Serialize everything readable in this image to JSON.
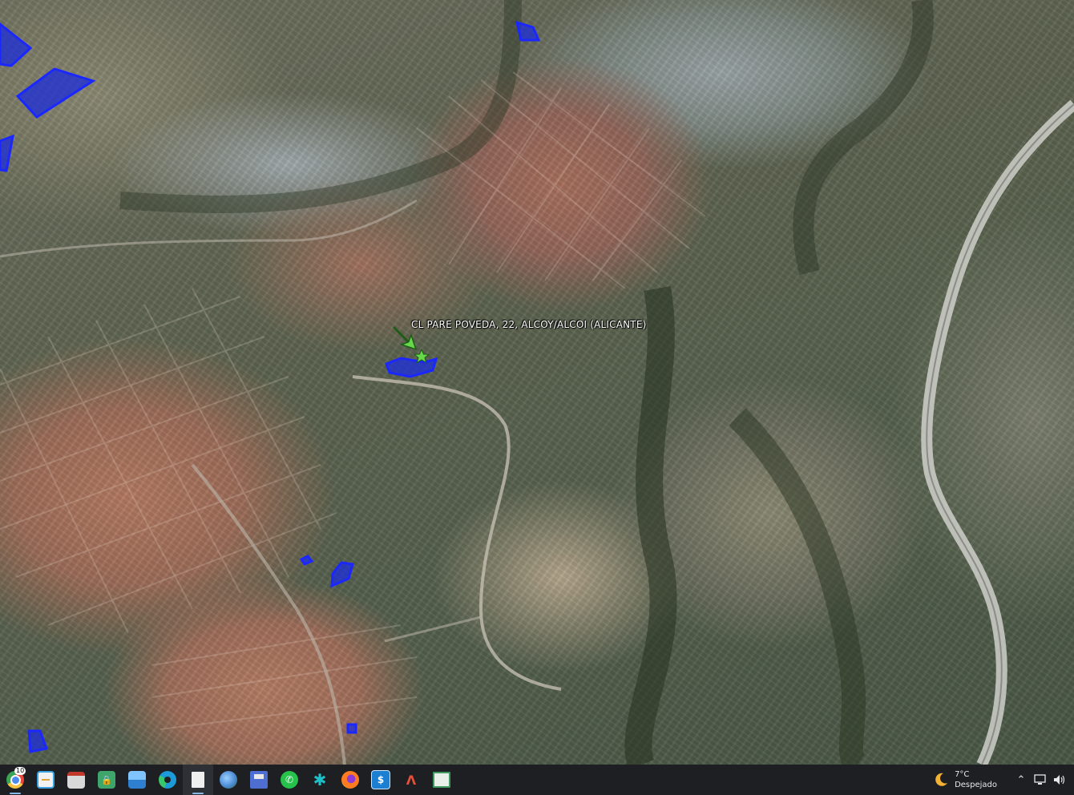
{
  "map": {
    "placemark_label": "CL PARE POVEDA, 22, ALCOY/ALCOI (ALICANTE)",
    "parcel_color": "#1f2fd6",
    "placemark_color": "#66d84a"
  },
  "taskbar": {
    "apps": [
      {
        "name": "chrome",
        "badge": "10",
        "color": "#e7483b"
      },
      {
        "name": "notes",
        "badge": "",
        "color": "#3aa1e0"
      },
      {
        "name": "window",
        "badge": "",
        "color": "#5a7fb0"
      },
      {
        "name": "lock-folder",
        "badge": "",
        "color": "#3fa66b"
      },
      {
        "name": "photos",
        "badge": "",
        "color": "#2f7fd0"
      },
      {
        "name": "edge",
        "badge": "",
        "color": "#1d9ad8"
      },
      {
        "name": "document",
        "badge": "",
        "color": "#e9e9e9"
      },
      {
        "name": "google-earth",
        "badge": "",
        "color": "#4c8bd6"
      },
      {
        "name": "save",
        "badge": "",
        "color": "#4e6ed1"
      },
      {
        "name": "whatsapp",
        "badge": "",
        "color": "#27c24c"
      },
      {
        "name": "spiral",
        "badge": "",
        "color": "#1ec0c9"
      },
      {
        "name": "firefox",
        "badge": "",
        "color": "#ff7b1f"
      },
      {
        "name": "dollar-app",
        "badge": "",
        "color": "#1c7fd1"
      },
      {
        "name": "arrow-app",
        "badge": "",
        "color": "#2a3a8f"
      },
      {
        "name": "presentation",
        "badge": "",
        "color": "#3e9a5e"
      }
    ],
    "weather": {
      "temp": "7°C",
      "condition": "Despejado"
    }
  }
}
